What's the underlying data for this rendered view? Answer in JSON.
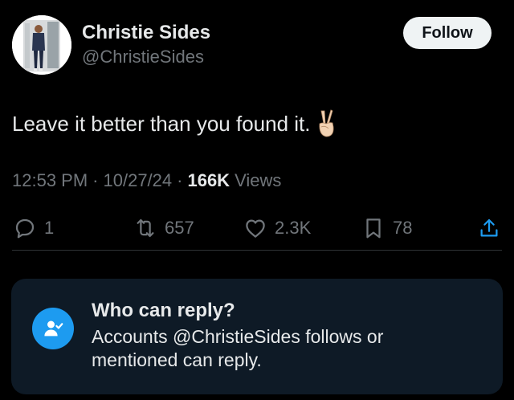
{
  "author": {
    "name": "Christie Sides",
    "handle": "@ChristieSides",
    "avatar_icon": "profile-photo"
  },
  "follow_button": {
    "label": "Follow"
  },
  "tweet": {
    "text": "Leave it better than you found it.",
    "emoji": "victory-hand"
  },
  "meta": {
    "time": "12:53 PM",
    "separator": "·",
    "date": "10/27/24",
    "views_count": "166K",
    "views_label": "Views"
  },
  "actions": {
    "reply": {
      "icon": "reply-icon",
      "count": "1"
    },
    "retweet": {
      "icon": "retweet-icon",
      "count": "657"
    },
    "like": {
      "icon": "heart-icon",
      "count": "2.3K"
    },
    "bookmark": {
      "icon": "bookmark-icon",
      "count": "78"
    },
    "share": {
      "icon": "share-icon"
    }
  },
  "reply_restriction": {
    "title": "Who can reply?",
    "description": "Accounts @ChristieSides follows or mentioned can reply.",
    "icon": "user-check-icon"
  },
  "colors": {
    "background": "#000000",
    "text_primary": "#e7e9ea",
    "text_secondary": "#71767b",
    "accent": "#1d9bf0",
    "panel": "#0e1a26"
  }
}
